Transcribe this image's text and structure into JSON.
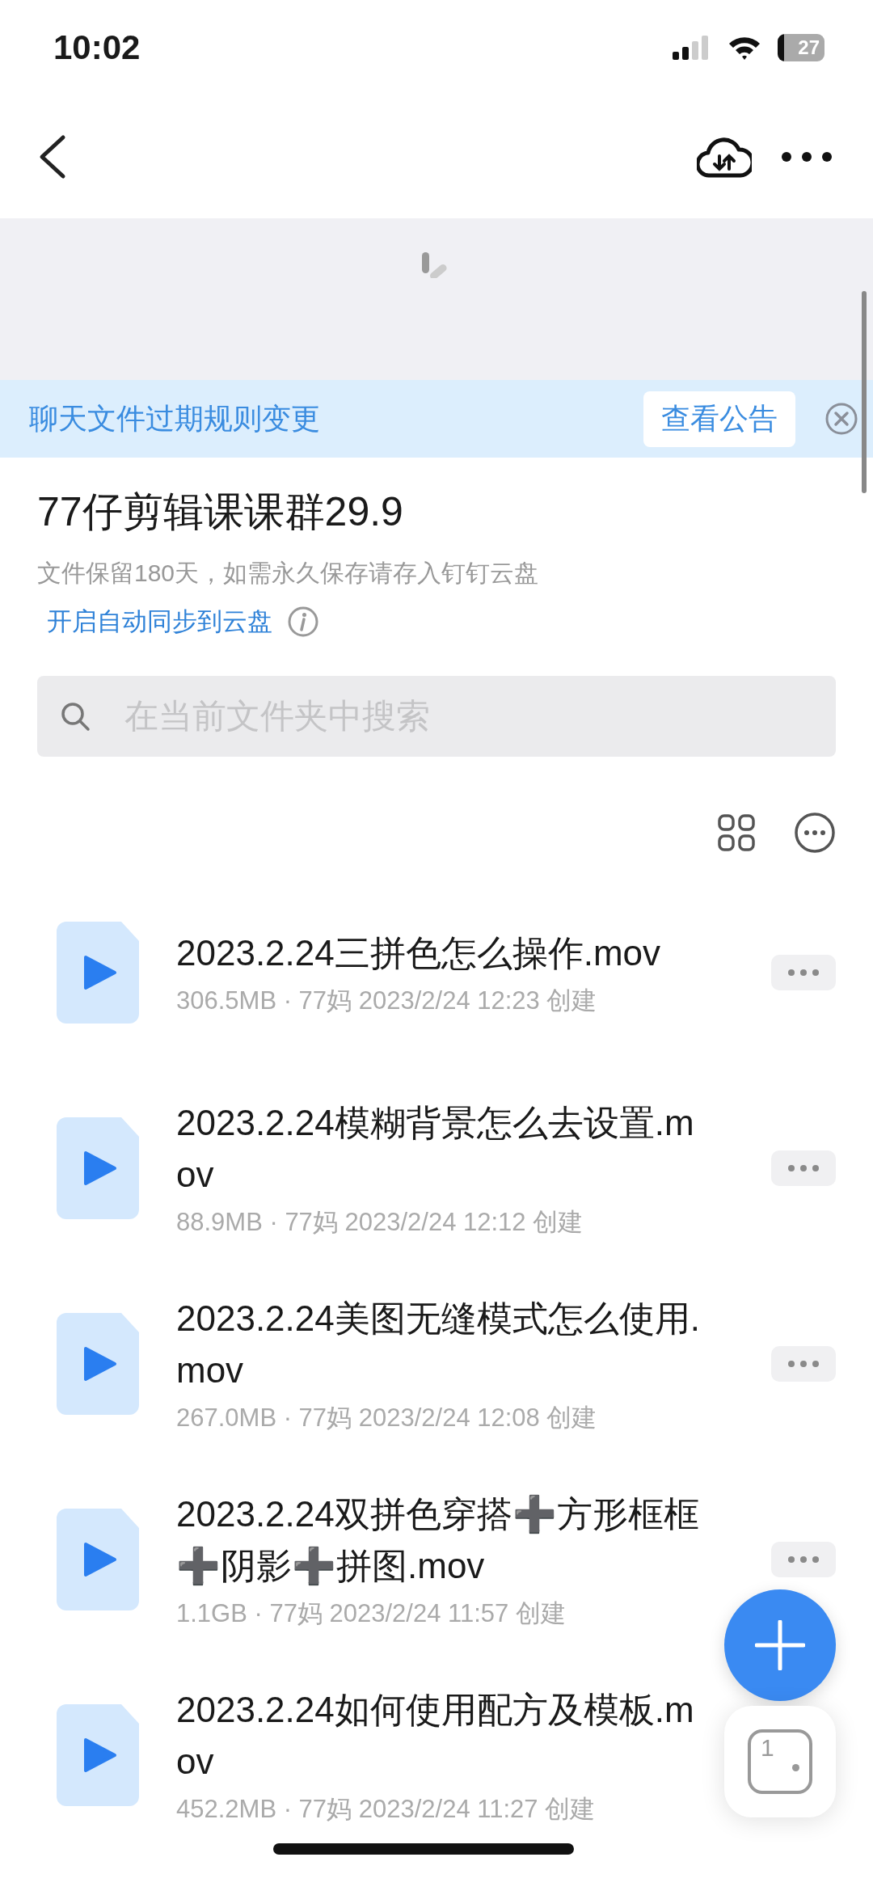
{
  "status_bar": {
    "time": "10:02",
    "battery": "27"
  },
  "notice": {
    "text": "聊天文件过期规则变更",
    "button": "查看公告"
  },
  "folder": {
    "title": "77仔剪辑课课群29.9",
    "subtitle": "文件保留180天，如需永久保存请存入钉钉云盘",
    "sync_link": "开启自动同步到云盘"
  },
  "search": {
    "placeholder": "在当前文件夹中搜索"
  },
  "files": [
    {
      "name": "2023.2.24三拼色怎么操作.mov",
      "meta": "306.5MB · 77妈 2023/2/24 12:23 创建",
      "more_button": true
    },
    {
      "name": "2023.2.24模糊背景怎么去设置.mov",
      "meta": "88.9MB · 77妈 2023/2/24 12:12 创建",
      "more_button": true
    },
    {
      "name": "2023.2.24美图无缝模式怎么使用.mov",
      "meta": "267.0MB · 77妈 2023/2/24 12:08 创建",
      "more_button": true
    },
    {
      "name": "2023.2.24双拼色穿搭➕方形框框➕阴影➕拼图.mov",
      "meta": "1.1GB · 77妈 2023/2/24 11:57 创建",
      "more_button": true
    },
    {
      "name": "2023.2.24如何使用配方及模板.mov",
      "meta": "452.2MB · 77妈 2023/2/24 11:27 创建",
      "more_button": false
    }
  ],
  "floating_badge": "1"
}
